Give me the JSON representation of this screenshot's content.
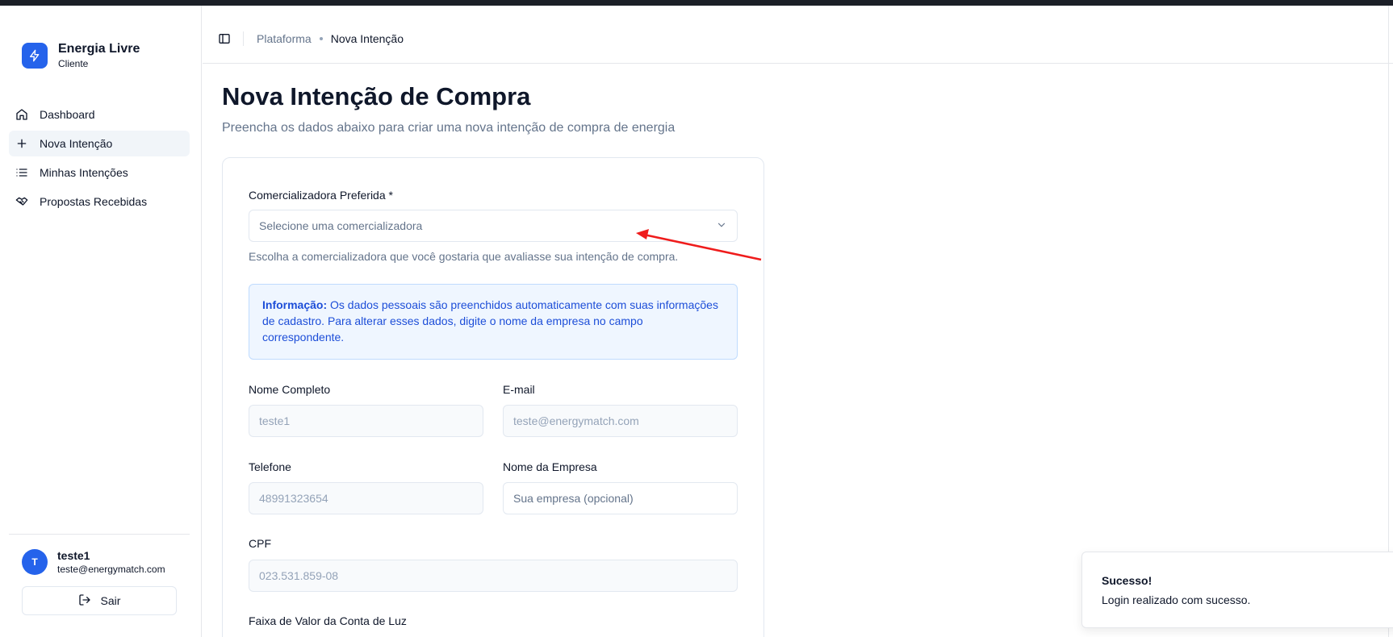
{
  "brand": {
    "name": "Energia Livre",
    "subtitle": "Cliente",
    "color": "#2563eb",
    "icon": "zap-icon"
  },
  "sidebar": {
    "items": [
      {
        "label": "Dashboard",
        "icon": "home-icon",
        "active": false
      },
      {
        "label": "Nova Intenção",
        "icon": "plus-icon",
        "active": true
      },
      {
        "label": "Minhas Intenções",
        "icon": "list-icon",
        "active": false
      },
      {
        "label": "Propostas Recebidas",
        "icon": "handshake-icon",
        "active": false
      }
    ],
    "user": {
      "initial": "T",
      "name": "teste1",
      "email": "teste@energymatch.com"
    },
    "logout_label": "Sair"
  },
  "header": {
    "breadcrumb": {
      "root": "Plataforma",
      "current": "Nova Intenção"
    }
  },
  "main": {
    "title": "Nova Intenção de Compra",
    "subtitle": "Preencha os dados abaixo para criar uma nova intenção de compra de energia",
    "form": {
      "supplier": {
        "label": "Comercializadora Preferida *",
        "placeholder": "Selecione uma comercializadora",
        "help": "Escolha a comercializadora que você gostaria que avaliasse sua intenção de compra."
      },
      "info": {
        "title": "Informação:",
        "text": "Os dados pessoais são preenchidos automaticamente com suas informações de cadastro. Para alterar esses dados, digite o nome da empresa no campo correspondente."
      },
      "full_name": {
        "label": "Nome Completo",
        "value": "teste1"
      },
      "email": {
        "label": "E-mail",
        "value": "teste@energymatch.com"
      },
      "phone": {
        "label": "Telefone",
        "value": "48991323654"
      },
      "company": {
        "label": "Nome da Empresa",
        "placeholder": "Sua empresa (opcional)"
      },
      "cpf": {
        "label": "CPF",
        "value": "023.531.859-08"
      },
      "bill_range": {
        "label": "Faixa de Valor da Conta de Luz"
      }
    }
  },
  "toast": {
    "title": "Sucesso!",
    "message": "Login realizado com sucesso."
  },
  "colors": {
    "accent": "#2563eb",
    "info_bg": "#eff6ff",
    "info_text": "#1d4ed8",
    "annotation_arrow": "#ef1c1c"
  }
}
